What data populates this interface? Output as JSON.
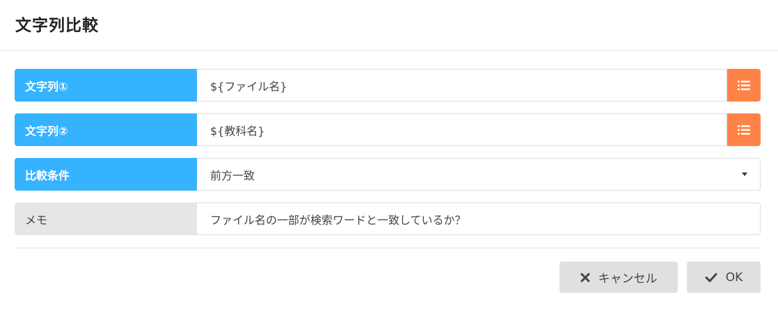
{
  "dialog": {
    "title": "文字列比較"
  },
  "fields": {
    "string1": {
      "label": "文字列①",
      "value": "${ファイル名}",
      "button_icon": "list-icon"
    },
    "string2": {
      "label": "文字列②",
      "value": "${教科名}",
      "button_icon": "list-icon"
    },
    "condition": {
      "label": "比較条件",
      "value": "前方一致",
      "icon": "caret-down-icon"
    },
    "memo": {
      "label": "メモ",
      "value": "ファイル名の一部が検索ワードと一致しているか？"
    }
  },
  "footer": {
    "cancel_label": "キャンセル",
    "cancel_icon": "close-icon",
    "ok_label": "OK",
    "ok_icon": "check-icon"
  },
  "colors": {
    "label_blue": "#35b3ff",
    "label_gray": "#e6e6e6",
    "action_orange": "#ff8347",
    "button_gray": "#e0e0e0"
  }
}
